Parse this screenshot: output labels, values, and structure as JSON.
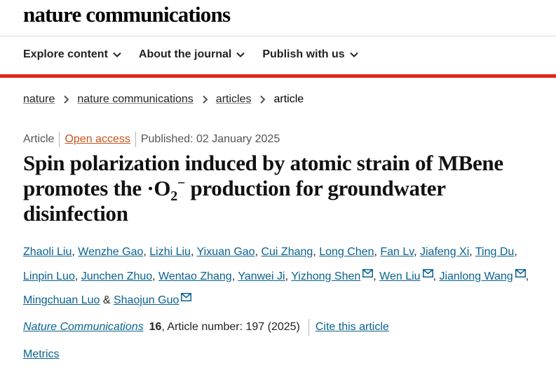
{
  "header": {
    "brand": "nature communications",
    "nav": [
      {
        "label": "Explore content"
      },
      {
        "label": "About the journal"
      },
      {
        "label": "Publish with us"
      }
    ]
  },
  "breadcrumb": {
    "items": [
      "nature",
      "nature communications",
      "articles"
    ],
    "current": "article"
  },
  "meta": {
    "type": "Article",
    "access": "Open access",
    "published": "Published: 02 January 2025"
  },
  "title": {
    "part1": "Spin polarization induced by atomic strain of MBene promotes the ·O",
    "sub": "2",
    "sup": "−",
    "part2": " production for groundwater disinfection"
  },
  "authors": [
    {
      "name": "Zhaoli Liu",
      "email": false
    },
    {
      "name": "Wenzhe Gao",
      "email": false
    },
    {
      "name": "Lizhi Liu",
      "email": false
    },
    {
      "name": "Yixuan Gao",
      "email": false
    },
    {
      "name": "Cui Zhang",
      "email": false
    },
    {
      "name": "Long Chen",
      "email": false
    },
    {
      "name": "Fan Lv",
      "email": false
    },
    {
      "name": "Jiafeng Xi",
      "email": false
    },
    {
      "name": "Ting Du",
      "email": false
    },
    {
      "name": "Linpin Luo",
      "email": false
    },
    {
      "name": "Junchen Zhuo",
      "email": false
    },
    {
      "name": "Wentao Zhang",
      "email": false
    },
    {
      "name": "Yanwei Ji",
      "email": false
    },
    {
      "name": "Yizhong Shen",
      "email": true
    },
    {
      "name": "Wen Liu",
      "email": true
    },
    {
      "name": "Jianlong Wang",
      "email": true
    },
    {
      "name": "Mingchuan Luo",
      "email": false
    },
    {
      "name": "Shaojun Guo",
      "email": true
    }
  ],
  "citation": {
    "journal": "Nature Communications",
    "volume": "16",
    "article_number": ", Article number: 197 (2025)",
    "cite_label": "Cite this article"
  },
  "metrics_label": "Metrics",
  "colors": {
    "accent_red": "#e0251b",
    "link_blue": "#0a6290",
    "open_access": "#c4541b"
  }
}
